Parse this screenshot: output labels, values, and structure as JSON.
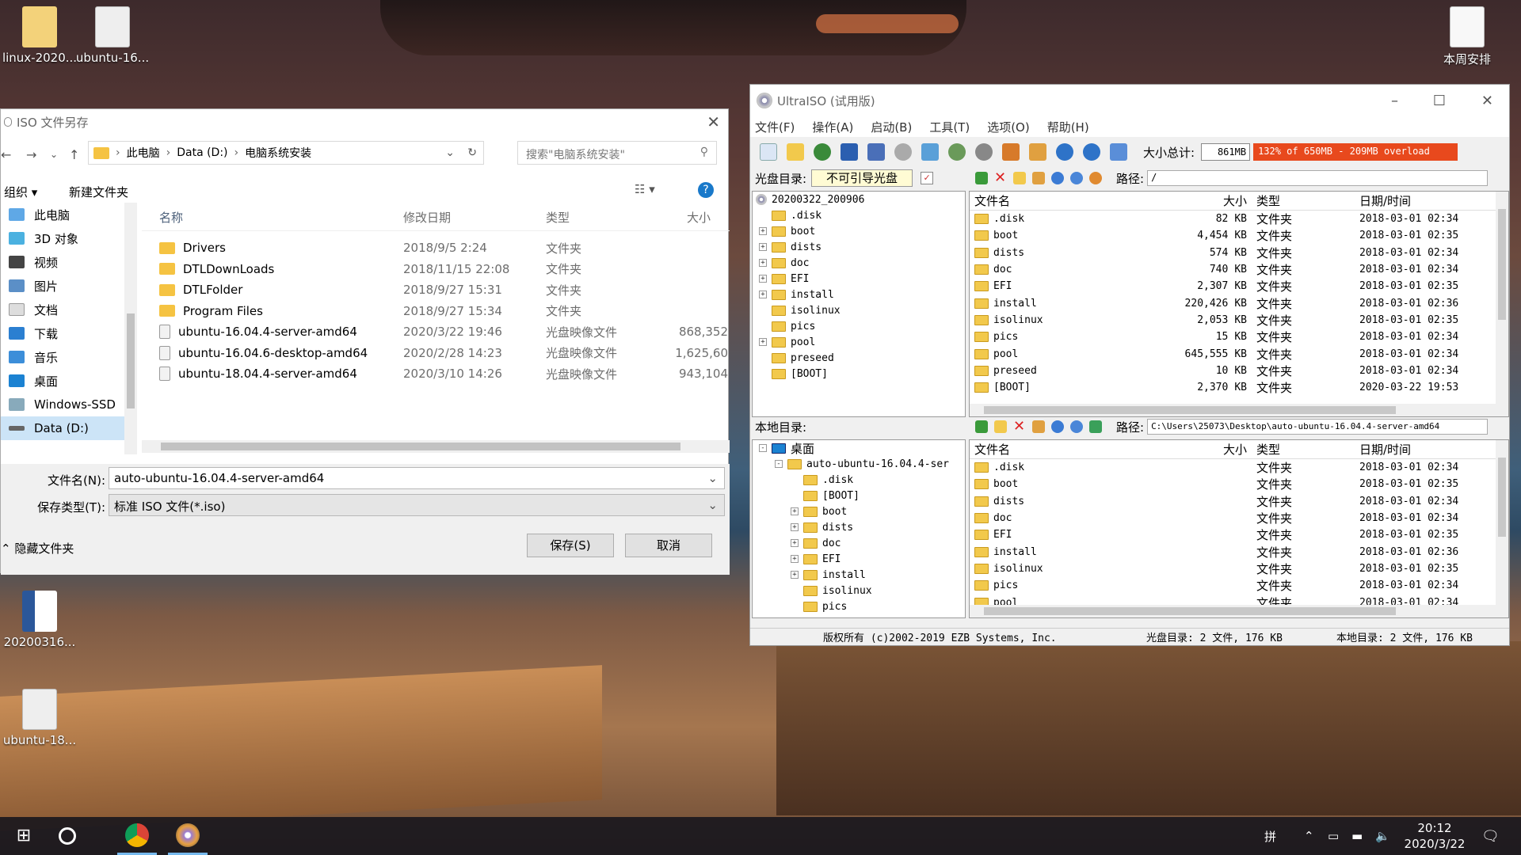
{
  "desktop": {
    "icons": [
      {
        "label": "linux-2020..."
      },
      {
        "label": "ubuntu-16..."
      },
      {
        "label": "本周安排"
      },
      {
        "label": "20200316..."
      },
      {
        "label": "ubuntu-18..."
      }
    ]
  },
  "save_dialog": {
    "title": "ISO 文件另存",
    "address": {
      "seg1": "此电脑",
      "seg2": "Data (D:)",
      "seg3": "电脑系统安装"
    },
    "search_placeholder": "搜索\"电脑系统安装\"",
    "toolbar": {
      "organize": "组织 ▾",
      "new_folder": "新建文件夹"
    },
    "nav": [
      {
        "label": "此电脑"
      },
      {
        "label": "3D 对象"
      },
      {
        "label": "视频"
      },
      {
        "label": "图片"
      },
      {
        "label": "文档"
      },
      {
        "label": "下载"
      },
      {
        "label": "音乐"
      },
      {
        "label": "桌面"
      },
      {
        "label": "Windows-SSD"
      },
      {
        "label": "Data (D:)"
      }
    ],
    "columns": {
      "name": "名称",
      "date": "修改日期",
      "type": "类型",
      "size": "大小"
    },
    "files": [
      {
        "name": "Drivers",
        "date": "2018/9/5 2:24",
        "type": "文件夹",
        "size": ""
      },
      {
        "name": "DTLDownLoads",
        "date": "2018/11/15 22:08",
        "type": "文件夹",
        "size": ""
      },
      {
        "name": "DTLFolder",
        "date": "2018/9/27 15:31",
        "type": "文件夹",
        "size": ""
      },
      {
        "name": "Program Files",
        "date": "2018/9/27 15:34",
        "type": "文件夹",
        "size": ""
      },
      {
        "name": "ubuntu-16.04.4-server-amd64",
        "date": "2020/3/22 19:46",
        "type": "光盘映像文件",
        "size": "868,352"
      },
      {
        "name": "ubuntu-16.04.6-desktop-amd64",
        "date": "2020/2/28 14:23",
        "type": "光盘映像文件",
        "size": "1,625,60"
      },
      {
        "name": "ubuntu-18.04.4-server-amd64",
        "date": "2020/3/10 14:26",
        "type": "光盘映像文件",
        "size": "943,104"
      }
    ],
    "filename_label": "文件名(N):",
    "filename_value": "auto-ubuntu-16.04.4-server-amd64",
    "filetype_label": "保存类型(T):",
    "filetype_value": "标准 ISO 文件(*.iso)",
    "hide_folders": "隐藏文件夹",
    "save_btn": "保存(S)",
    "cancel_btn": "取消"
  },
  "ultraiso": {
    "title": "UltraISO (试用版)",
    "menu": [
      "文件(F)",
      "操作(A)",
      "启动(B)",
      "工具(T)",
      "选项(O)",
      "帮助(H)"
    ],
    "size_label": "大小总计:",
    "size_value": "861MB",
    "overload_text": "132% of 650MB - 209MB overload",
    "disc_dir_label": "光盘目录:",
    "boot_status": "不可引导光盘",
    "path_label": "路径:",
    "iso_path": "/",
    "iso_tree": [
      {
        "label": "20200322_200906",
        "pm": ""
      },
      {
        "label": ".disk",
        "pm": " "
      },
      {
        "label": "boot",
        "pm": "+"
      },
      {
        "label": "dists",
        "pm": "+"
      },
      {
        "label": "doc",
        "pm": "+"
      },
      {
        "label": "EFI",
        "pm": "+"
      },
      {
        "label": "install",
        "pm": "+"
      },
      {
        "label": "isolinux",
        "pm": " "
      },
      {
        "label": "pics",
        "pm": " "
      },
      {
        "label": "pool",
        "pm": "+"
      },
      {
        "label": "preseed",
        "pm": " "
      },
      {
        "label": "[BOOT]",
        "pm": " "
      }
    ],
    "list_cols": {
      "name": "文件名",
      "size": "大小",
      "type": "类型",
      "date": "日期/时间"
    },
    "iso_files": [
      {
        "name": ".disk",
        "size": "82",
        "unit": "KB",
        "type": "文件夹",
        "date": "2018-03-01 02:34"
      },
      {
        "name": "boot",
        "size": "4,454",
        "unit": "KB",
        "type": "文件夹",
        "date": "2018-03-01 02:35"
      },
      {
        "name": "dists",
        "size": "574",
        "unit": "KB",
        "type": "文件夹",
        "date": "2018-03-01 02:34"
      },
      {
        "name": "doc",
        "size": "740",
        "unit": "KB",
        "type": "文件夹",
        "date": "2018-03-01 02:34"
      },
      {
        "name": "EFI",
        "size": "2,307",
        "unit": "KB",
        "type": "文件夹",
        "date": "2018-03-01 02:35"
      },
      {
        "name": "install",
        "size": "220,426",
        "unit": "KB",
        "type": "文件夹",
        "date": "2018-03-01 02:36"
      },
      {
        "name": "isolinux",
        "size": "2,053",
        "unit": "KB",
        "type": "文件夹",
        "date": "2018-03-01 02:35"
      },
      {
        "name": "pics",
        "size": "15",
        "unit": "KB",
        "type": "文件夹",
        "date": "2018-03-01 02:34"
      },
      {
        "name": "pool",
        "size": "645,555",
        "unit": "KB",
        "type": "文件夹",
        "date": "2018-03-01 02:34"
      },
      {
        "name": "preseed",
        "size": "10",
        "unit": "KB",
        "type": "文件夹",
        "date": "2018-03-01 02:34"
      },
      {
        "name": "[BOOT]",
        "size": "2,370",
        "unit": "KB",
        "type": "文件夹",
        "date": "2020-03-22 19:53"
      }
    ],
    "local_dir_label": "本地目录:",
    "local_path": "C:\\Users\\25073\\Desktop\\auto-ubuntu-16.04.4-server-amd64",
    "local_tree": [
      {
        "label": "桌面",
        "pm": "-",
        "indent": 0
      },
      {
        "label": "auto-ubuntu-16.04.4-ser",
        "pm": "-",
        "indent": 1
      },
      {
        "label": ".disk",
        "pm": " ",
        "indent": 2
      },
      {
        "label": "[BOOT]",
        "pm": " ",
        "indent": 2
      },
      {
        "label": "boot",
        "pm": "+",
        "indent": 2
      },
      {
        "label": "dists",
        "pm": "+",
        "indent": 2
      },
      {
        "label": "doc",
        "pm": "+",
        "indent": 2
      },
      {
        "label": "EFI",
        "pm": "+",
        "indent": 2
      },
      {
        "label": "install",
        "pm": "+",
        "indent": 2
      },
      {
        "label": "isolinux",
        "pm": " ",
        "indent": 2
      },
      {
        "label": "pics",
        "pm": " ",
        "indent": 2
      }
    ],
    "local_files": [
      {
        "name": ".disk",
        "type": "文件夹",
        "date": "2018-03-01 02:34"
      },
      {
        "name": "boot",
        "type": "文件夹",
        "date": "2018-03-01 02:35"
      },
      {
        "name": "dists",
        "type": "文件夹",
        "date": "2018-03-01 02:34"
      },
      {
        "name": "doc",
        "type": "文件夹",
        "date": "2018-03-01 02:34"
      },
      {
        "name": "EFI",
        "type": "文件夹",
        "date": "2018-03-01 02:35"
      },
      {
        "name": "install",
        "type": "文件夹",
        "date": "2018-03-01 02:36"
      },
      {
        "name": "isolinux",
        "type": "文件夹",
        "date": "2018-03-01 02:35"
      },
      {
        "name": "pics",
        "type": "文件夹",
        "date": "2018-03-01 02:34"
      },
      {
        "name": "pool",
        "type": "文件夹",
        "date": "2018-03-01 02:34"
      }
    ],
    "status": {
      "copyright": "版权所有 (c)2002-2019 EZB Systems, Inc.",
      "disc_summary": "光盘目录: 2 文件, 176 KB",
      "local_summary": "本地目录: 2 文件, 176 KB"
    }
  },
  "taskbar": {
    "time": "20:12",
    "date": "2020/3/22",
    "ime": "拼"
  }
}
